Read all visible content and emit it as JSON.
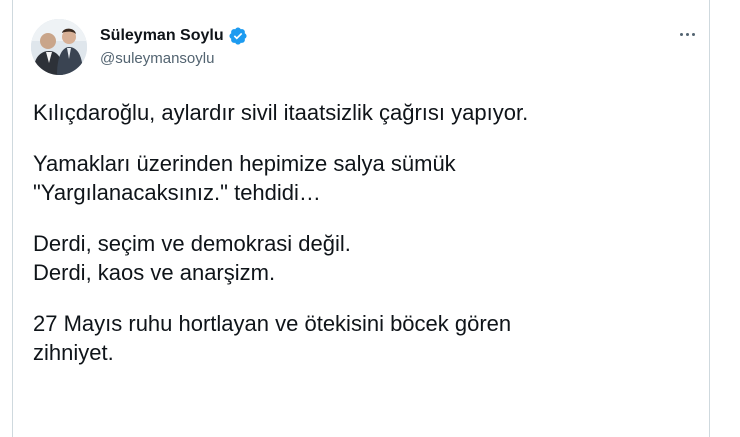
{
  "author": {
    "display_name": "Süleyman Soylu",
    "handle": "@suleymansoylu",
    "verified": true,
    "avatar_icon": "profile-photo-avatar",
    "verified_icon": "verified-badge-icon",
    "verified_color": "#1d9bf0"
  },
  "menu": {
    "icon": "more-options-icon"
  },
  "tweet": {
    "paragraphs": [
      {
        "lines": [
          "Kılıçdaroğlu, aylardır sivil itaatsizlik çağrısı yapıyor."
        ]
      },
      {
        "lines": [
          "Yamakları üzerinden hepimize salya sümük",
          "\"Yargılanacaksınız.\" tehdidi…"
        ]
      },
      {
        "lines": [
          "Derdi, seçim ve demokrasi değil.",
          "Derdi, kaos ve anarşizm."
        ]
      },
      {
        "lines": [
          "27 Mayıs ruhu hortlayan ve ötekisini böcek gören",
          "zihniyet."
        ]
      }
    ]
  },
  "colors": {
    "text_primary": "#0f1419",
    "text_secondary": "#536471",
    "border": "#cfd9de"
  }
}
